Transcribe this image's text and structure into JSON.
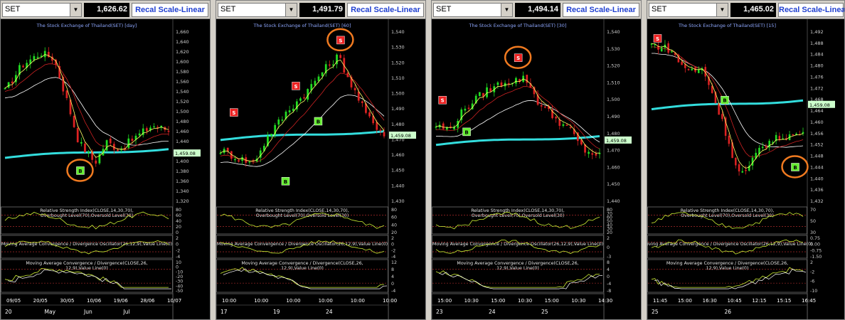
{
  "panels": [
    {
      "symbol": "SET",
      "price": "1,626.62",
      "recal_label": "Recal Scale-Linear",
      "title": "The Stock Exchange of Thailand(SET) [day]",
      "last_tag": "1,459.08",
      "y_ticks": [
        "1,660",
        "1,640",
        "1,620",
        "1,600",
        "1,580",
        "1,560",
        "1,540",
        "1,520",
        "1,500",
        "1,480",
        "1,460",
        "1,440",
        "1,420",
        "1,400",
        "1,380",
        "1,360",
        "1,340",
        "1,320"
      ],
      "rsi_label": "Relative Strength Index(CLOSE,14,30,70),Overbought Level(70),Oversold Level(30)",
      "rsi_ticks": [
        "80",
        "60",
        "40",
        "20",
        "0"
      ],
      "osc_label": "Moving Average Convergence / Divergence Oscillator(26,12,9),Value Line(0)",
      "osc_ticks": [
        "2",
        "0",
        "-2",
        "-4"
      ],
      "macd_label": "Moving Average Convergence / Divergence(CLOSE,26,12,9),Value Line(0)",
      "macd_ticks": [
        "10",
        "0",
        "-10",
        "-20",
        "-30",
        "-40",
        "-50"
      ],
      "x_top": [
        "09/05",
        "20/05",
        "30/05",
        "10/06",
        "19/06",
        "28/06",
        "10/07"
      ],
      "x_bottom": [
        "20",
        "May",
        "Jun",
        "Jul"
      ],
      "signals": [
        {
          "t": "B",
          "circled": true
        }
      ]
    },
    {
      "symbol": "SET",
      "price": "1,491.79",
      "recal_label": "Recal Scale-Linear",
      "title": "The Stock Exchange of Thailand(SET) [60]",
      "last_tag": "1,459.08",
      "y_ticks": [
        "1,540",
        "1,530",
        "1,520",
        "1,510",
        "1,500",
        "1,490",
        "1,480",
        "1,470",
        "1,460",
        "1,450",
        "1,440",
        "1,430"
      ],
      "rsi_label": "Relative Strength Index(CLOSE,14,30,70),Overbought Level(70),Oversold Level(30)",
      "rsi_ticks": [
        "80",
        "60",
        "40",
        "20"
      ],
      "osc_label": "Moving Average Convergence / Divergence Oscillator(26,12,9),Value Line(0)",
      "osc_ticks": [
        "2",
        "0",
        "-2",
        "-4"
      ],
      "macd_label": "Moving Average Convergence / Divergence(CLOSE,26,12,9),Value Line(0)",
      "macd_ticks": [
        "12",
        "8",
        "4",
        "0",
        "-4"
      ],
      "x_top": [
        "10:00",
        "10:00",
        "10:00",
        "10:00",
        "10:00",
        "10:00"
      ],
      "x_bottom": [
        "17",
        "19",
        "24"
      ],
      "signals": [
        {
          "t": "S",
          "circled": false
        },
        {
          "t": "B",
          "circled": false
        },
        {
          "t": "S",
          "circled": false
        },
        {
          "t": "B",
          "circled": false
        },
        {
          "t": "S",
          "circled": true
        }
      ]
    },
    {
      "symbol": "SET",
      "price": "1,494.14",
      "recal_label": "Recal Scale-Linear",
      "title": "The Stock Exchange of Thailand(SET) [30]",
      "last_tag": "1,459.08",
      "y_ticks": [
        "1,540",
        "1,530",
        "1,520",
        "1,510",
        "1,500",
        "1,490",
        "1,480",
        "1,470",
        "1,460",
        "1,450",
        "1,440"
      ],
      "rsi_label": "Relative Strength Index(CLOSE,14,30,70),Overbought Level(70),Oversold Level(30)",
      "rsi_ticks": [
        "80",
        "70",
        "60",
        "50",
        "40",
        "30",
        "20"
      ],
      "osc_label": "Moving Average Convergence / Divergence Oscillator(26,12,9),Value Line(0)",
      "osc_ticks": [
        "2",
        "0",
        "-3"
      ],
      "macd_label": "Moving Average Convergence / Divergence(CLOSE,26,12,9),Value Line(0)",
      "macd_ticks": [
        "8",
        "4",
        "0",
        "-4",
        "-8"
      ],
      "x_top": [
        "15:00",
        "10:30",
        "15:00",
        "10:30",
        "15:00",
        "10:30",
        "14:30"
      ],
      "x_bottom": [
        "23",
        "24",
        "25"
      ],
      "signals": [
        {
          "t": "S",
          "circled": false
        },
        {
          "t": "B",
          "circled": false
        },
        {
          "t": "S",
          "circled": true
        }
      ]
    },
    {
      "symbol": "SET",
      "price": "1,465.02",
      "recal_label": "Recal Scale-Linear",
      "title": "The Stock Exchange of Thailand(SET) [15]",
      "last_tag": "1,459.08",
      "y_ticks": [
        "1,492",
        "1,488",
        "1,484",
        "1,480",
        "1,476",
        "1,472",
        "1,468",
        "1,464",
        "1,460",
        "1,456",
        "1,452",
        "1,448",
        "1,444",
        "1,440",
        "1,436",
        "1,432"
      ],
      "rsi_label": "Relative Strength Index(CLOSE,14,30,70),Overbought Level(70),Oversold Level(30)",
      "rsi_ticks": [
        "70",
        "50",
        "30"
      ],
      "osc_label": "Moving Average Convergence / Divergence Oscillator(26,12,9),Value Line(0)",
      "osc_ticks": [
        "0.75",
        "0.00",
        "-0.75",
        "-1.50"
      ],
      "macd_label": "Moving Average Convergence / Divergence(CLOSE,26,12,9),Value Line(0)",
      "macd_ticks": [
        "2",
        "-2",
        "-6",
        "-10"
      ],
      "x_top": [
        "11:45",
        "15:00",
        "16:30",
        "10:45",
        "12:15",
        "15:15",
        "16:45"
      ],
      "x_bottom": [
        "25",
        "26"
      ],
      "signals": [
        {
          "t": "S",
          "circled": false
        },
        {
          "t": "B",
          "circled": false
        },
        {
          "t": "B",
          "circled": true
        }
      ]
    }
  ],
  "colors": {
    "up": "#22dd22",
    "down": "#dd2222",
    "ma_fast": "#ffff66",
    "ma_mid": "#cc2222",
    "ma_slow": "#ffffff",
    "ma_long": "#33dddd",
    "indicator": "#ccee33",
    "level": "#cc3333",
    "circle": "#f07a20",
    "tag_bg": "#ccffcc",
    "grid": "#666666"
  }
}
